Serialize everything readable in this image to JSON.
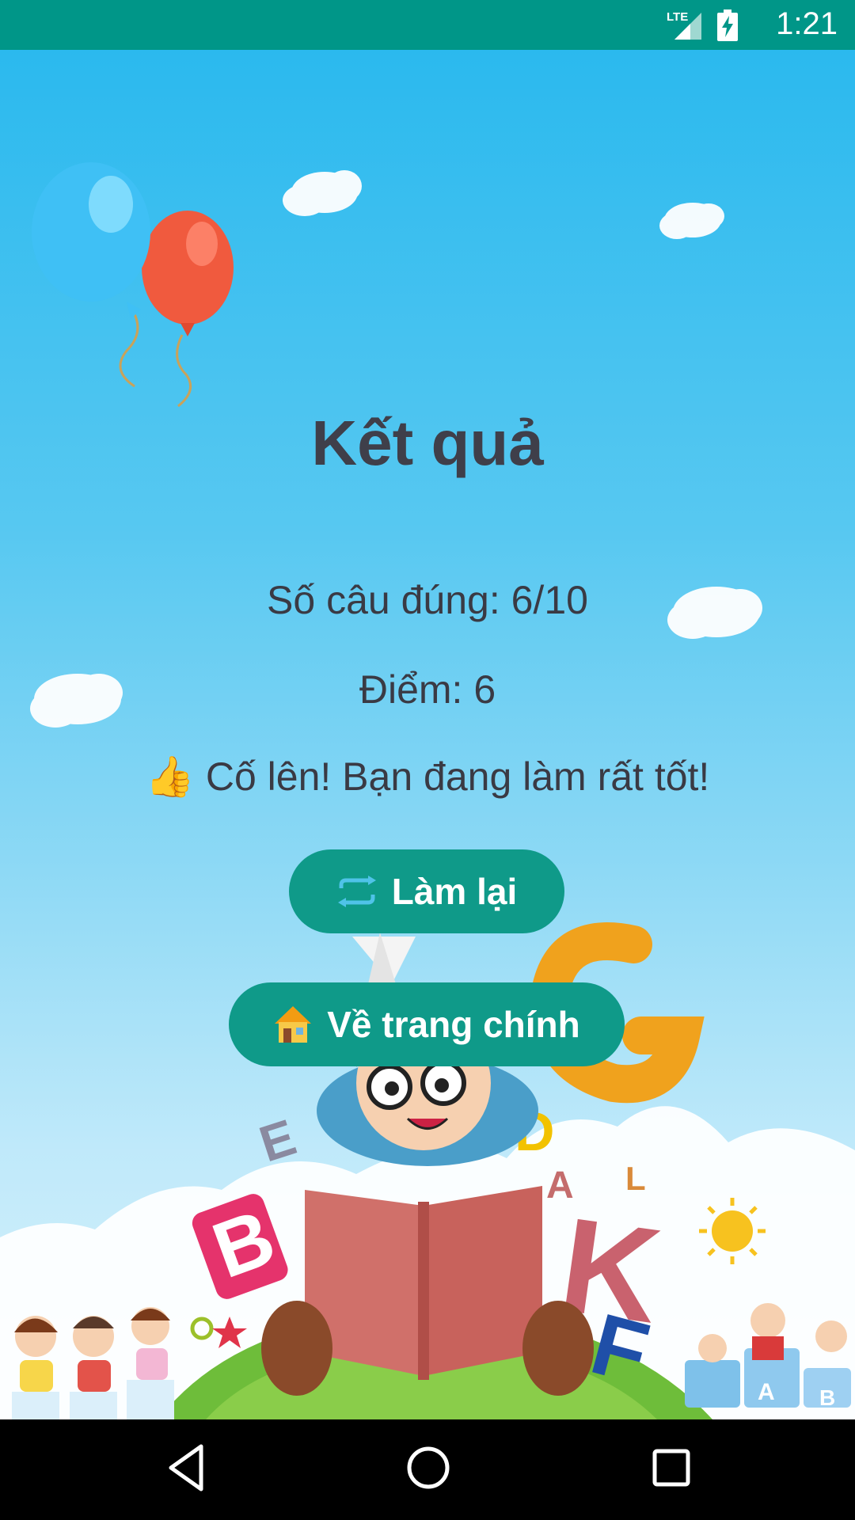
{
  "status_bar": {
    "time": "1:21",
    "network": "LTE"
  },
  "result": {
    "title": "Kết quả",
    "correct_line": "Số câu đúng: 6/10",
    "score_line": "Điểm: 6",
    "message": "Cố lên! Bạn đang làm rất tốt!",
    "message_emoji": "👍"
  },
  "buttons": {
    "retry_label": "Làm lại",
    "home_label": "Về trang chính",
    "retry_icon": "repeat-icon",
    "home_icon": "house-icon"
  },
  "colors": {
    "status_bar": "#009688",
    "button": "#0f9a89",
    "title_text": "#3f3f4a"
  }
}
